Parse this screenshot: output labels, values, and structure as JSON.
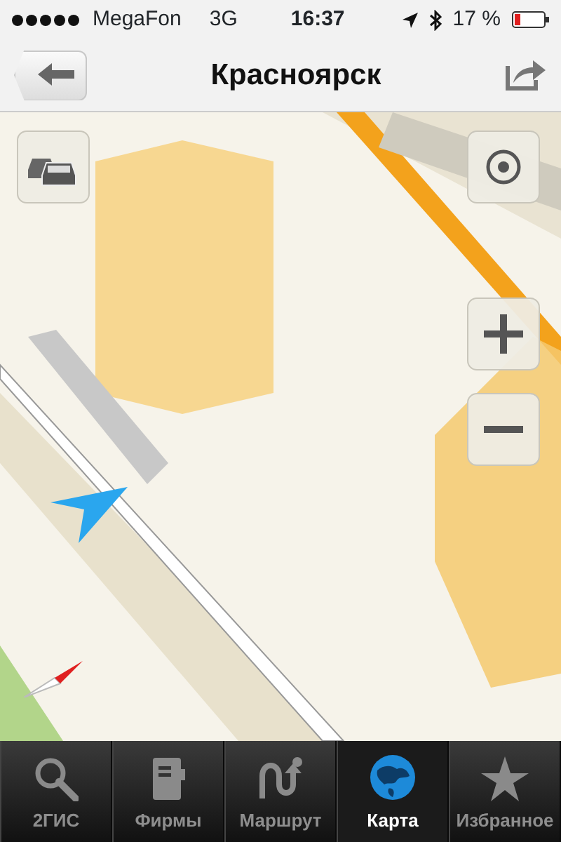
{
  "status_bar": {
    "carrier": "MegaFon",
    "network": "3G",
    "time": "16:37",
    "battery": "17 %"
  },
  "nav_bar": {
    "title": "Красноярск"
  },
  "tabs": [
    {
      "label": "2ГИС",
      "kind": "search",
      "selected": false
    },
    {
      "label": "Фирмы",
      "kind": "notebook",
      "selected": false
    },
    {
      "label": "Маршрут",
      "kind": "route",
      "selected": false
    },
    {
      "label": "Карта",
      "kind": "globe",
      "selected": true
    },
    {
      "label": "Избранное",
      "kind": "star",
      "selected": false
    }
  ]
}
